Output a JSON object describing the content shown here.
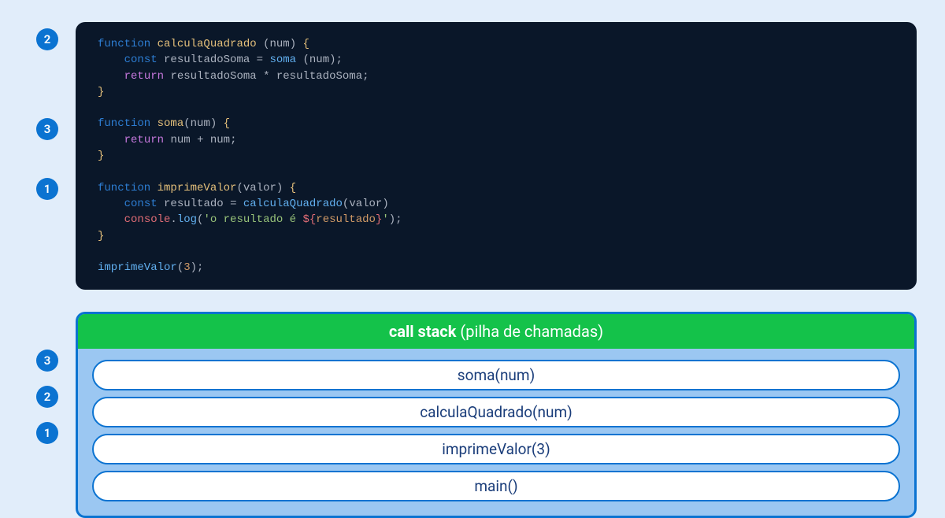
{
  "code_badges": {
    "b1": "2",
    "b2": "3",
    "b3": "1"
  },
  "code": {
    "line1": {
      "kw": "function",
      "fn": "calculaQuadrado",
      "params": "num"
    },
    "line2": {
      "kw": "const",
      "var": "resultadoSoma",
      "fn": "soma",
      "args": "num"
    },
    "line3": {
      "kw": "return",
      "expr_left": "resultadoSoma",
      "op": "*",
      "expr_right": "resultadoSoma"
    },
    "line5": {
      "kw": "function",
      "fn": "soma",
      "params": "num"
    },
    "line6": {
      "kw": "return",
      "expr_left": "num",
      "op": "+",
      "expr_right": "num"
    },
    "line8": {
      "kw": "function",
      "fn": "imprimeValor",
      "params": "valor"
    },
    "line9": {
      "kw": "const",
      "var": "resultado",
      "fn": "calculaQuadrado",
      "args": "valor"
    },
    "line10": {
      "obj": "console",
      "method": "log",
      "str_pre": "'o resultado é ",
      "interp_open": "${",
      "interp_var": "resultado",
      "interp_close": "}",
      "str_post": "'"
    },
    "line12": {
      "fn": "imprimeValor",
      "arg": "3"
    }
  },
  "stack": {
    "header_bold": "call stack",
    "header_paren": "(pilha de chamadas)",
    "items": [
      "soma(num)",
      "calculaQuadrado(num)",
      "imprimeValor(3)",
      "main()"
    ],
    "badges": {
      "b1": "3",
      "b2": "2",
      "b3": "1"
    }
  }
}
